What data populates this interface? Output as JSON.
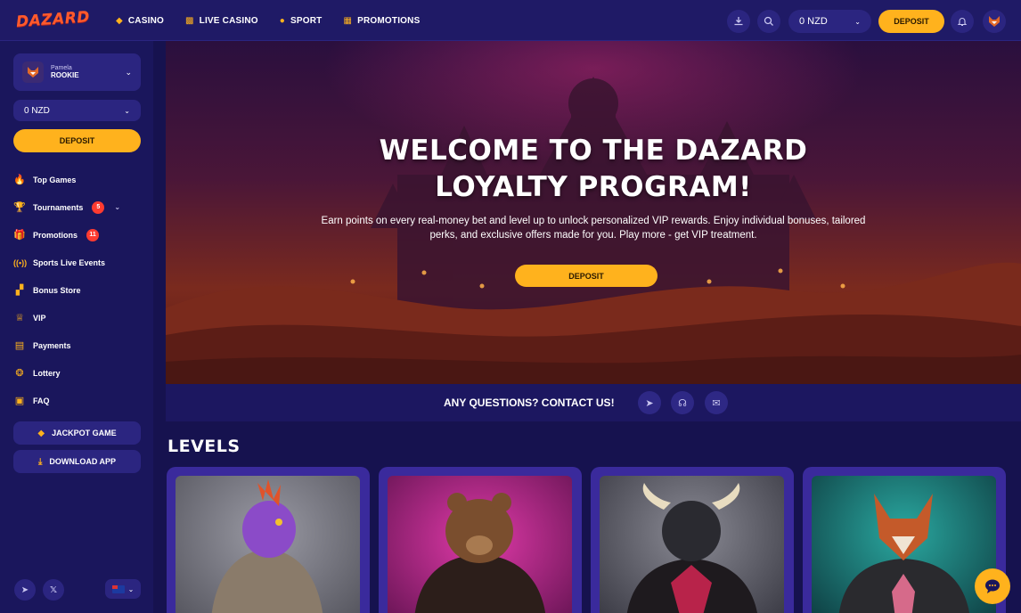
{
  "brand": {
    "logo_text": "DAZARD"
  },
  "topnav": {
    "items": [
      {
        "label": "CASINO",
        "icon": "casino-icon"
      },
      {
        "label": "LIVE CASINO",
        "icon": "live-casino-icon"
      },
      {
        "label": "SPORT",
        "icon": "sport-icon"
      },
      {
        "label": "PROMOTIONS",
        "icon": "gift-icon"
      }
    ],
    "balance": "0 NZD",
    "deposit_label": "DEPOSIT"
  },
  "sidebar": {
    "user": {
      "name": "Pamela",
      "rank": "ROOKIE"
    },
    "balance": "0 NZD",
    "deposit_label": "DEPOSIT",
    "menu": [
      {
        "label": "Top Games",
        "icon": "fire-icon"
      },
      {
        "label": "Tournaments",
        "icon": "trophy-icon",
        "badge": "5"
      },
      {
        "label": "Promotions",
        "icon": "gift-icon",
        "badge": "11"
      },
      {
        "label": "Sports Live Events",
        "icon": "broadcast-icon"
      },
      {
        "label": "Bonus Store",
        "icon": "basket-icon"
      },
      {
        "label": "VIP",
        "icon": "crown-icon"
      },
      {
        "label": "Payments",
        "icon": "wallet-icon"
      },
      {
        "label": "Lottery",
        "icon": "lottery-icon"
      },
      {
        "label": "FAQ",
        "icon": "faq-icon"
      }
    ],
    "jackpot_label": "JACKPOT GAME",
    "download_label": "DOWNLOAD APP"
  },
  "hero": {
    "title_line1": "WELCOME TO THE DAZARD",
    "title_line2": "LOYALTY PROGRAM!",
    "description": "Earn points on every real-money bet and level up to unlock personalized VIP rewards. Enjoy individual bonuses, tailored perks, and exclusive offers made for you. Play more - get VIP treatment.",
    "deposit_label": "DEPOSIT"
  },
  "contact": {
    "label": "ANY QUESTIONS? CONTACT US!"
  },
  "levels": {
    "title": "LEVELS",
    "cards": [
      {
        "character": "purple-lizard-in-hoodie",
        "bg": "#8a8a94"
      },
      {
        "character": "bear-in-leather-jacket",
        "bg": "#b0248a"
      },
      {
        "character": "bull-in-leather-jacket",
        "bg": "#6a6a74"
      },
      {
        "character": "fox-in-leather-jacket",
        "bg": "#1e6d6a"
      }
    ]
  },
  "colors": {
    "accent": "#ffb21d",
    "sidebar": "#1a165c",
    "panel": "#2b2580",
    "badge": "#ff3b30"
  }
}
